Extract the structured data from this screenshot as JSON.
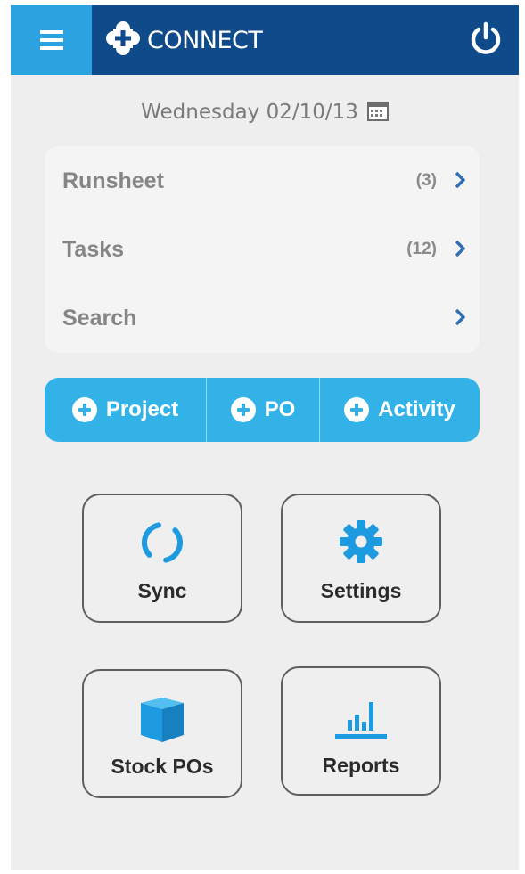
{
  "header": {
    "app_title": "CONNECT",
    "colors": {
      "bar": "#0f4a8a",
      "menu_button": "#2aa3e0",
      "icon": "#ffffff"
    },
    "menu_icon": "hamburger-menu-icon",
    "logo_icon": "cross-badge-logo-icon",
    "power_icon": "power-icon"
  },
  "date_bar": {
    "date": "Wednesday 02/10/13",
    "icon": "calendar-icon"
  },
  "nav_list": {
    "items": [
      {
        "label": "Runsheet",
        "count": "(3)",
        "icon": "chevron-right-icon"
      },
      {
        "label": "Tasks",
        "count": "(12)",
        "icon": "chevron-right-icon"
      },
      {
        "label": "Search",
        "count": "",
        "icon": "chevron-right-icon"
      }
    ]
  },
  "quick_add": {
    "color": "#33b2e8",
    "buttons": [
      {
        "label": "Project",
        "icon": "plus-circle-icon"
      },
      {
        "label": "PO",
        "icon": "plus-circle-icon"
      },
      {
        "label": "Activity",
        "icon": "plus-circle-icon"
      }
    ]
  },
  "tiles": {
    "accent": "#1e9be0",
    "items": [
      {
        "label": "Sync",
        "icon": "sync-icon"
      },
      {
        "label": "Settings",
        "icon": "gear-icon"
      },
      {
        "label": "Stock POs",
        "icon": "box-icon"
      },
      {
        "label": "Reports",
        "icon": "bar-chart-icon"
      }
    ]
  }
}
